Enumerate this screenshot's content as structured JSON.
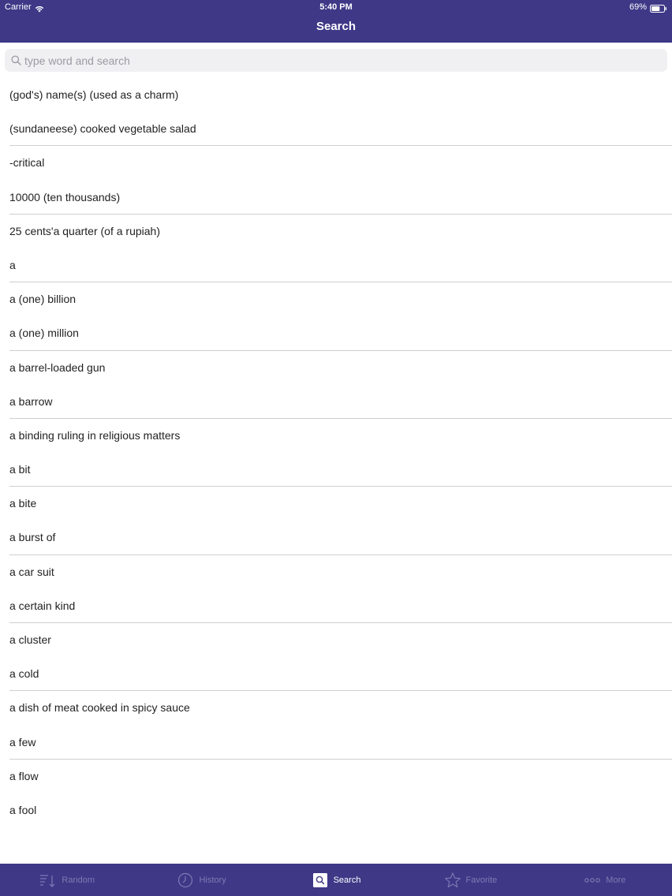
{
  "status": {
    "carrier": "Carrier",
    "time": "5:40 PM",
    "battery": "69%",
    "battery_level": 0.69
  },
  "nav": {
    "title": "Search"
  },
  "search": {
    "placeholder": "type word and search",
    "value": ""
  },
  "list": {
    "items": [
      "(god's) name(s) (used as a charm)",
      "(sundaneese) cooked vegetable salad",
      "-critical",
      "10000 (ten thousands)",
      "25 cents'a quarter (of a rupiah)",
      "a",
      "a (one) billion",
      "a (one) million",
      "a barrel-loaded gun",
      "a barrow",
      "a binding ruling in religious matters",
      "a bit",
      "a bite",
      "a burst of",
      "a car suit",
      "a certain kind",
      "a cluster",
      "a cold",
      "a dish of meat cooked in spicy sauce",
      "a few",
      "a flow",
      "a fool"
    ]
  },
  "tabbar": {
    "tabs": [
      {
        "label": "Random",
        "icon": "random-icon",
        "active": false
      },
      {
        "label": "History",
        "icon": "history-icon",
        "active": false
      },
      {
        "label": "Search",
        "icon": "search-icon",
        "active": true
      },
      {
        "label": "Favorite",
        "icon": "star-icon",
        "active": false
      },
      {
        "label": "More",
        "icon": "more-icon",
        "active": false
      }
    ]
  },
  "colors": {
    "bar_background": "#3e3887",
    "tab_inactive": "#7f7bb4",
    "tab_active": "#ffffff",
    "separator": "#cfcfd4"
  }
}
